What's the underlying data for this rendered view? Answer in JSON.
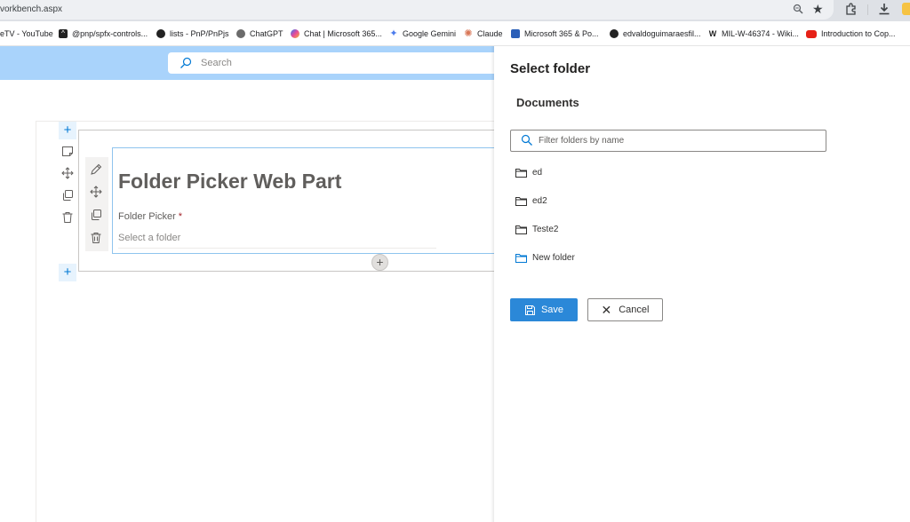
{
  "browser": {
    "url": "vorkbench.aspx",
    "bookmarks": [
      {
        "label": "eTV - YouTube",
        "icon": "youtube-icon"
      },
      {
        "label": "@pnp/spfx-controls...",
        "icon": "graduation-cap-icon"
      },
      {
        "label": "lists - PnP/PnPjs",
        "icon": "github-icon"
      },
      {
        "label": "ChatGPT",
        "icon": "chatgpt-icon"
      },
      {
        "label": "Chat | Microsoft 365...",
        "icon": "copilot-icon"
      },
      {
        "label": "Google Gemini",
        "icon": "gemini-icon"
      },
      {
        "label": "Claude",
        "icon": "claude-icon"
      },
      {
        "label": "Microsoft 365 & Po...",
        "icon": "microsoft-icon"
      },
      {
        "label": "edvaldoguimaraesfil...",
        "icon": "github-icon"
      },
      {
        "label": "MIL-W-46374 - Wiki...",
        "icon": "wikipedia-icon"
      },
      {
        "label": "Introduction to Cop...",
        "icon": "youtube-icon"
      }
    ]
  },
  "header": {
    "search_placeholder": "Search"
  },
  "webpart": {
    "title": "Folder Picker Web Part",
    "field_label": "Folder Picker",
    "required_marker": "*",
    "field_placeholder": "Select a folder"
  },
  "panel": {
    "title": "Select folder",
    "library": "Documents",
    "filter_placeholder": "Filter folders by name",
    "folders": [
      "ed",
      "ed2",
      "Teste2"
    ],
    "new_folder_label": "New folder",
    "save_label": "Save",
    "cancel_label": "Cancel"
  }
}
